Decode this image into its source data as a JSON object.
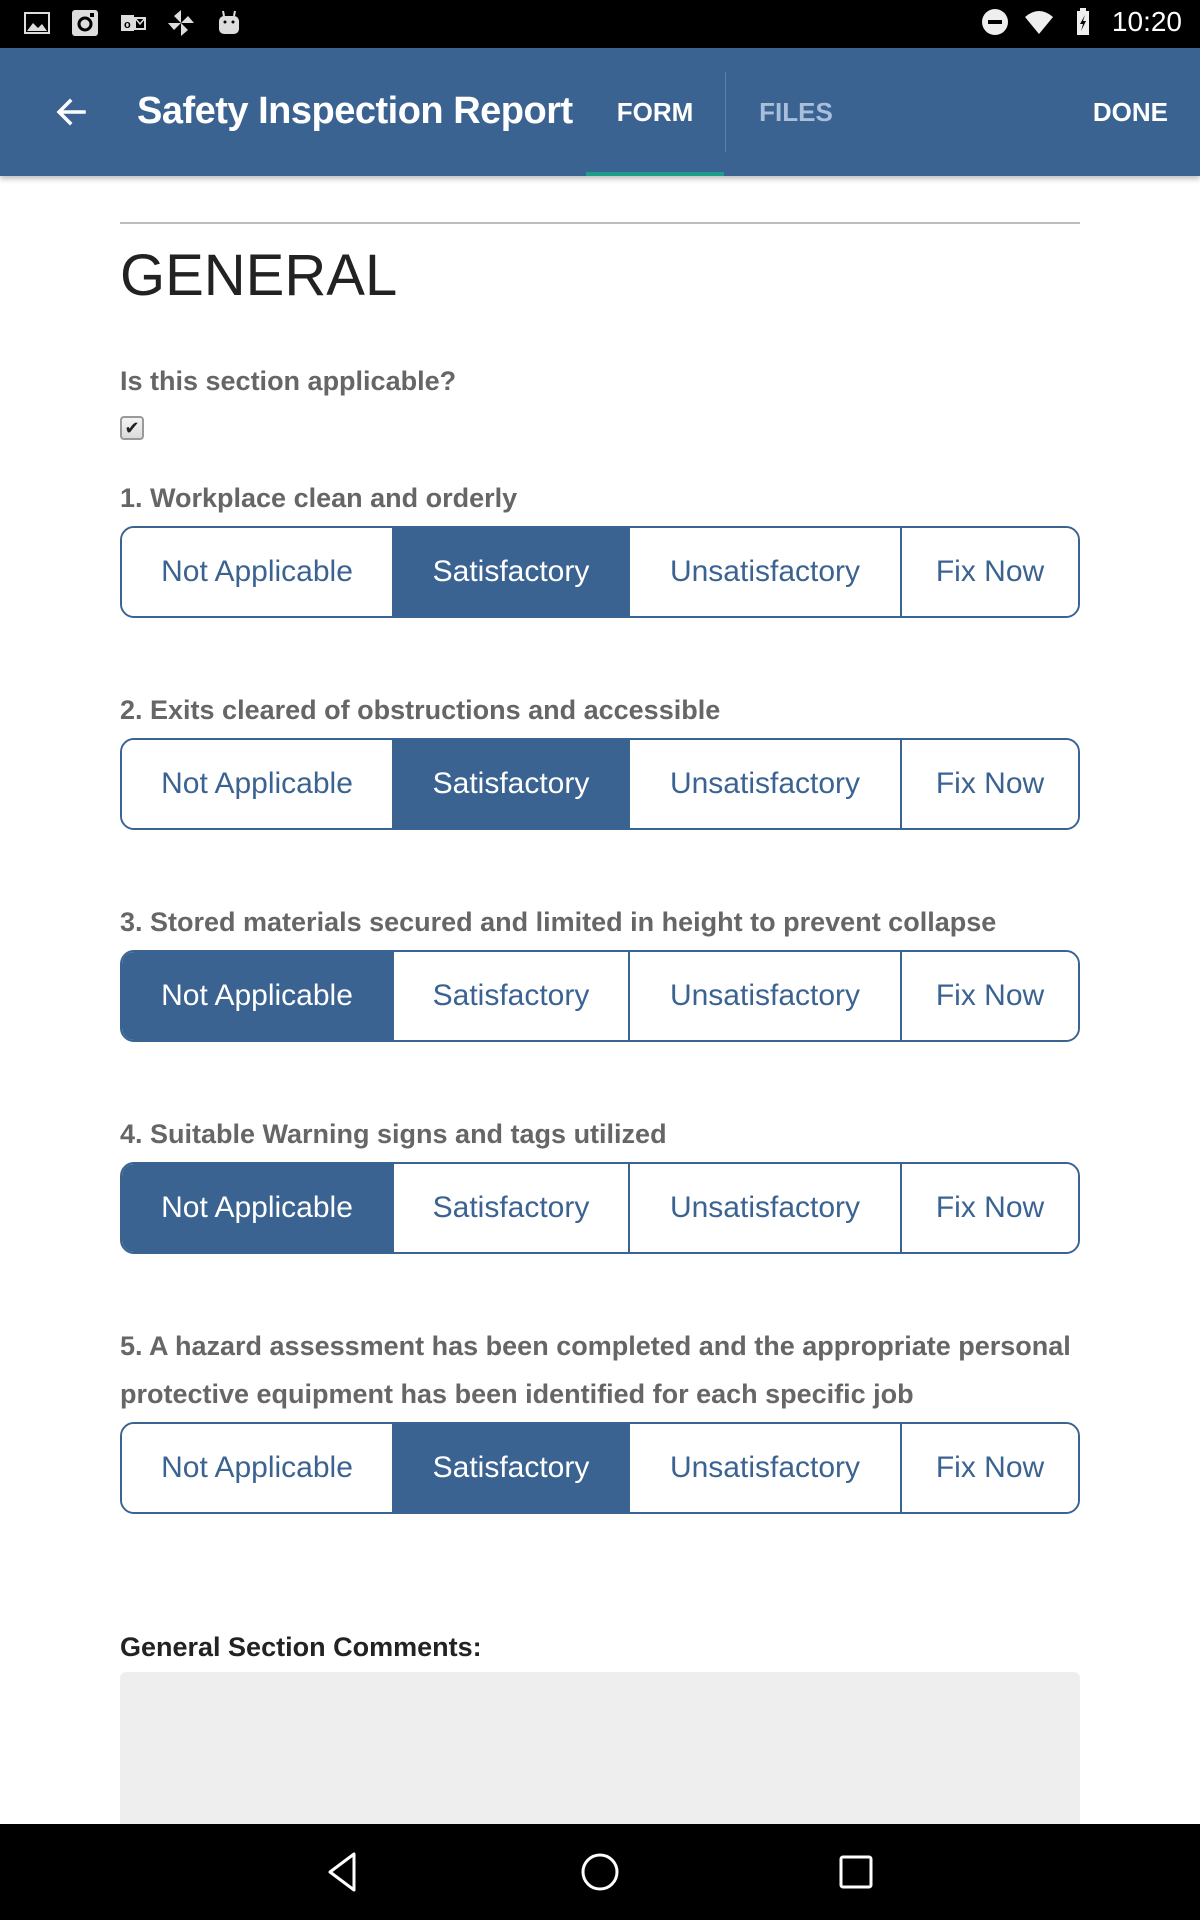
{
  "status_bar": {
    "time": "10:20",
    "left_icons": [
      "gallery-icon",
      "instagram-icon",
      "outlook-icon",
      "pinwheel-icon",
      "android-icon"
    ],
    "right_icons": [
      "do-not-disturb-icon",
      "wifi-icon",
      "battery-charging-icon"
    ]
  },
  "app_bar": {
    "title": "Safety Inspection Report",
    "tabs": [
      {
        "label": "FORM",
        "active": true
      },
      {
        "label": "FILES",
        "active": false
      }
    ],
    "done_label": "DONE",
    "color": "#3b6392",
    "tab_indicator_color": "#1e9e8a"
  },
  "section": {
    "title": "GENERAL",
    "applicable_label": "Is this section applicable?",
    "applicable_checked": true,
    "checkmark": "✔"
  },
  "options": [
    "Not Applicable",
    "Satisfactory",
    "Unsatisfactory",
    "Fix Now"
  ],
  "questions": [
    {
      "label": "1. Workplace clean and orderly",
      "selected": "Satisfactory"
    },
    {
      "label": "2. Exits cleared of obstructions and accessible",
      "selected": "Satisfactory"
    },
    {
      "label": "3. Stored materials secured and limited in height to prevent collapse",
      "selected": "Not Applicable"
    },
    {
      "label": "4. Suitable Warning signs and tags utilized",
      "selected": "Not Applicable"
    },
    {
      "label": "5. A hazard assessment has been completed and the appropriate personal protective equipment has been identified for each specific job",
      "selected": "Satisfactory"
    }
  ],
  "comments": {
    "label": "General Section Comments:",
    "value": ""
  },
  "nav_bar": {
    "buttons": [
      "back-icon",
      "home-icon",
      "recents-icon"
    ]
  }
}
